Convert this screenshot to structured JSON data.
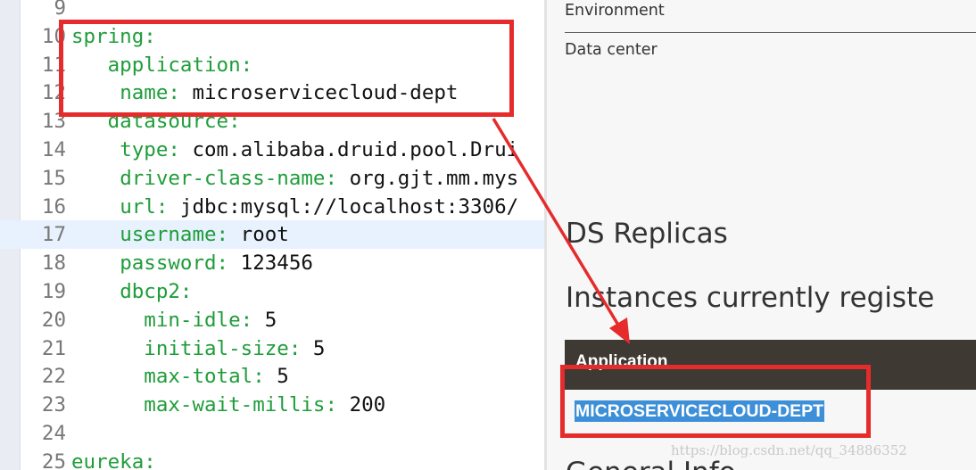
{
  "editor": {
    "lines": [
      {
        "num": "9",
        "key": "",
        "value": ""
      },
      {
        "num": "10",
        "key": "spring:",
        "value": ""
      },
      {
        "num": "11",
        "key": "application:",
        "value": ""
      },
      {
        "num": "12",
        "key": "name:",
        "value": " microservicecloud-dept"
      },
      {
        "num": "13",
        "key": "datasource:",
        "value": ""
      },
      {
        "num": "14",
        "key": "type:",
        "value": " com.alibaba.druid.pool.Drui"
      },
      {
        "num": "15",
        "key": "driver-class-name:",
        "value": " org.gjt.mm.mys"
      },
      {
        "num": "16",
        "key": "url:",
        "value": " jdbc:mysql://localhost:3306/"
      },
      {
        "num": "17",
        "key": "username:",
        "value": " root"
      },
      {
        "num": "18",
        "key": "password:",
        "value": " 123456"
      },
      {
        "num": "19",
        "key": "dbcp2:",
        "value": ""
      },
      {
        "num": "20",
        "key": "min-idle:",
        "value": " 5"
      },
      {
        "num": "21",
        "key": "initial-size:",
        "value": " 5"
      },
      {
        "num": "22",
        "key": "max-total:",
        "value": " 5"
      },
      {
        "num": "23",
        "key": "max-wait-millis:",
        "value": " 200"
      },
      {
        "num": "24",
        "key": "",
        "value": ""
      },
      {
        "num": "25",
        "key": "eureka:",
        "value": ""
      }
    ]
  },
  "eureka_page": {
    "info_rows": [
      "Environment",
      "Data center"
    ],
    "ds_replicas_heading": "DS Replicas",
    "instances_heading": "Instances currently registe",
    "table_header_application": "Application",
    "app_link": "MICROSERVICECLOUD-DEPT",
    "next_heading_partial": "General Info"
  },
  "watermark": "https://blog.csdn.net/qq_34886352",
  "colors": {
    "annotation_red": "#e52b2b",
    "yaml_key_green": "#1f9d3a",
    "table_header_bg": "#3e3933",
    "selection_blue": "#3d8fd8"
  }
}
